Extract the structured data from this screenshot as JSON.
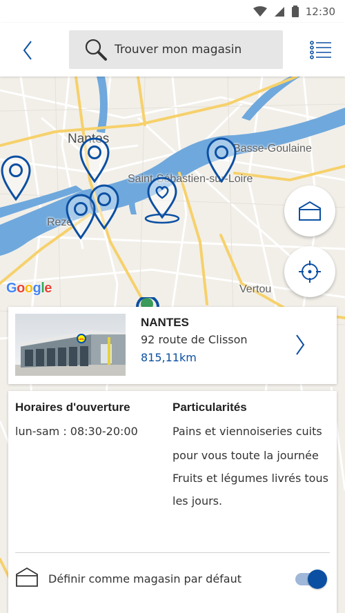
{
  "status_bar": {
    "time": "12:30"
  },
  "header": {
    "search_placeholder": "Trouver mon magasin"
  },
  "map": {
    "labels": {
      "nantes": "Nantes",
      "basse_goulaine": "Basse-Goulaine",
      "saint_sebastien": "Saint-Sébastien-sur-Loire",
      "reze": "Rezé",
      "vertou": "Vertou"
    },
    "google_logo": [
      "G",
      "o",
      "o",
      "g",
      "l",
      "e"
    ],
    "google_colors": [
      "#4285F4",
      "#EA4335",
      "#FBBC05",
      "#4285F4",
      "#34A853",
      "#EA4335"
    ]
  },
  "store": {
    "name": "NANTES",
    "address": "92 route de Clisson",
    "distance": "815,11km",
    "photo_sign": "LIDL"
  },
  "details": {
    "hours_title": "Horaires d'ouverture",
    "hours": "lun-sam : 08:30-20:00",
    "features_title": "Particularités",
    "features_lines": [
      "Pains et viennoiseries cuits",
      "pour vous toute la journée",
      "Fruits et légumes livrés tous",
      "les jours."
    ],
    "default_store_label": "Définir comme magasin par défaut",
    "default_store_enabled": true
  },
  "colors": {
    "accent": "#0b4fa2",
    "river": "#6fa8dc",
    "road_major": "#f6d16b",
    "map_bg": "#f2efe9"
  }
}
